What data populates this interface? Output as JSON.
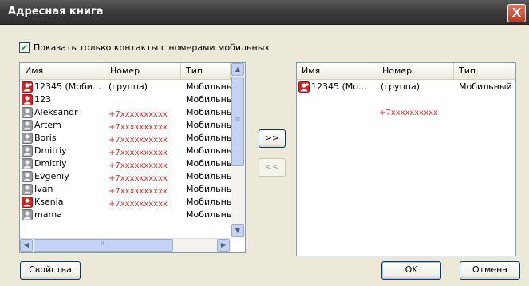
{
  "window": {
    "title": "Адресная книга",
    "close_glyph": "X"
  },
  "filter": {
    "checked": true,
    "check_glyph": "✔",
    "label": "Показать только контакты с номерами мобильных"
  },
  "columns": {
    "name": "Имя",
    "number": "Номер",
    "type": "Тип"
  },
  "left_list": {
    "rows": [
      {
        "name": "12345 (Моби…",
        "number": "(группа)",
        "type": "Мобильны",
        "icon": "group-contact-icon"
      },
      {
        "name": "123",
        "number": "",
        "type": "Мобильны",
        "icon": "contact-red-icon"
      },
      {
        "name": "Aleksandr",
        "number": "+7xxxxxxxxxx",
        "type": "Мобильны",
        "icon": "contact-gray-icon"
      },
      {
        "name": "Artem",
        "number": "+7xxxxxxxxxx",
        "type": "Мобильны",
        "icon": "contact-gray-icon"
      },
      {
        "name": "Boris",
        "number": "+7xxxxxxxxxx",
        "type": "Мобильны",
        "icon": "contact-gray-icon"
      },
      {
        "name": "Dmitriy",
        "number": "+7xxxxxxxxxx",
        "type": "Мобильны",
        "icon": "contact-gray-icon"
      },
      {
        "name": "Dmitriy",
        "number": "+7xxxxxxxxxx",
        "type": "Мобильны",
        "icon": "contact-gray-icon"
      },
      {
        "name": "Evgeniy",
        "number": "+7xxxxxxxxxx",
        "type": "Мобильны",
        "icon": "contact-gray-icon"
      },
      {
        "name": "Ivan",
        "number": "+7xxxxxxxxxx",
        "type": "Мобильны",
        "icon": "contact-gray-icon"
      },
      {
        "name": "Ksenia",
        "number": "+7xxxxxxxxxx",
        "type": "Мобильны",
        "icon": "contact-red-icon"
      },
      {
        "name": "mama",
        "number": "",
        "type": "Мобильны",
        "icon": "contact-gray-icon"
      }
    ]
  },
  "right_list": {
    "rows": [
      {
        "name": "12345 (Мо…",
        "number": "(группа)",
        "type": "Мобильный",
        "icon": "group-contact-icon"
      }
    ],
    "extra_number": "+7xxxxxxxxxx"
  },
  "transfer": {
    "add_label": ">>",
    "remove_label": "<<"
  },
  "scrollbar": {
    "up": "▲",
    "down": "▼",
    "left": "◀",
    "right": "▶",
    "grip": "≡",
    "hgrip": "III"
  },
  "buttons": {
    "properties": "Свойства",
    "ok": "OK",
    "cancel": "Отмена"
  },
  "colors": {
    "accent_red": "#e03030",
    "selection": "#316ac5",
    "titlebar": "#3d3d3d"
  }
}
